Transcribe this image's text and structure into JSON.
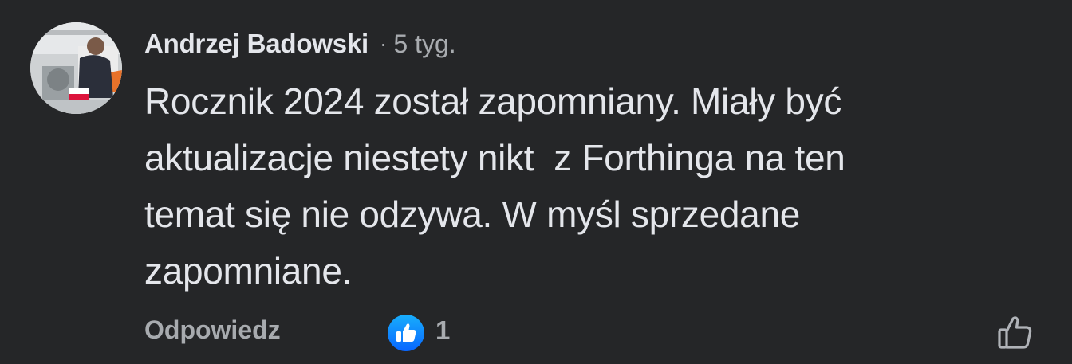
{
  "comment": {
    "author": "Andrzej Badowski",
    "separator": "·",
    "time": "5 tyg.",
    "text": "Rocznik 2024 został zapomniany. Miały być\naktualizacje niestety nikt  z Forthinga na ten\ntemat się nie odzywa. W myśl sprzedane\nzapomniane.",
    "reply_label": "Odpowiedz",
    "reaction_count": "1",
    "reaction_icon": "thumbs-up-reaction-icon",
    "like_icon": "thumbs-up-outline-icon"
  },
  "colors": {
    "background": "#252628",
    "primary_text": "#e4e6eb",
    "secondary_text": "#a8abaf",
    "reaction_blue": "#1877f2"
  }
}
